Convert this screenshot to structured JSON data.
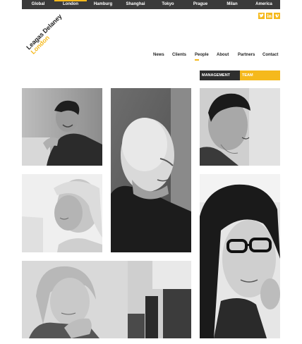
{
  "cities": [
    "Global",
    "London",
    "Hamburg",
    "Shanghai",
    "Tokyo",
    "Prague",
    "Milan",
    "America"
  ],
  "active_city": "London",
  "social": [
    "twitter-icon",
    "linkedin-icon",
    "vimeo-icon"
  ],
  "logo": {
    "line1": "Leagas Delaney",
    "line2": "London"
  },
  "nav": [
    "News",
    "Clients",
    "People",
    "About",
    "Partners",
    "Contact"
  ],
  "active_nav": "People",
  "subtabs": {
    "management": "Management",
    "team": "Team"
  },
  "colors": {
    "accent": "#f5b91c",
    "bar": "#3a3a3a",
    "dark_tab": "#2e2e2e"
  },
  "photos": [
    "person-smiling-leaning",
    "bald-man-profile",
    "young-man-profile",
    "blonde-woman-looking-down",
    "woman-with-glasses",
    "woman-hand-on-chin"
  ]
}
